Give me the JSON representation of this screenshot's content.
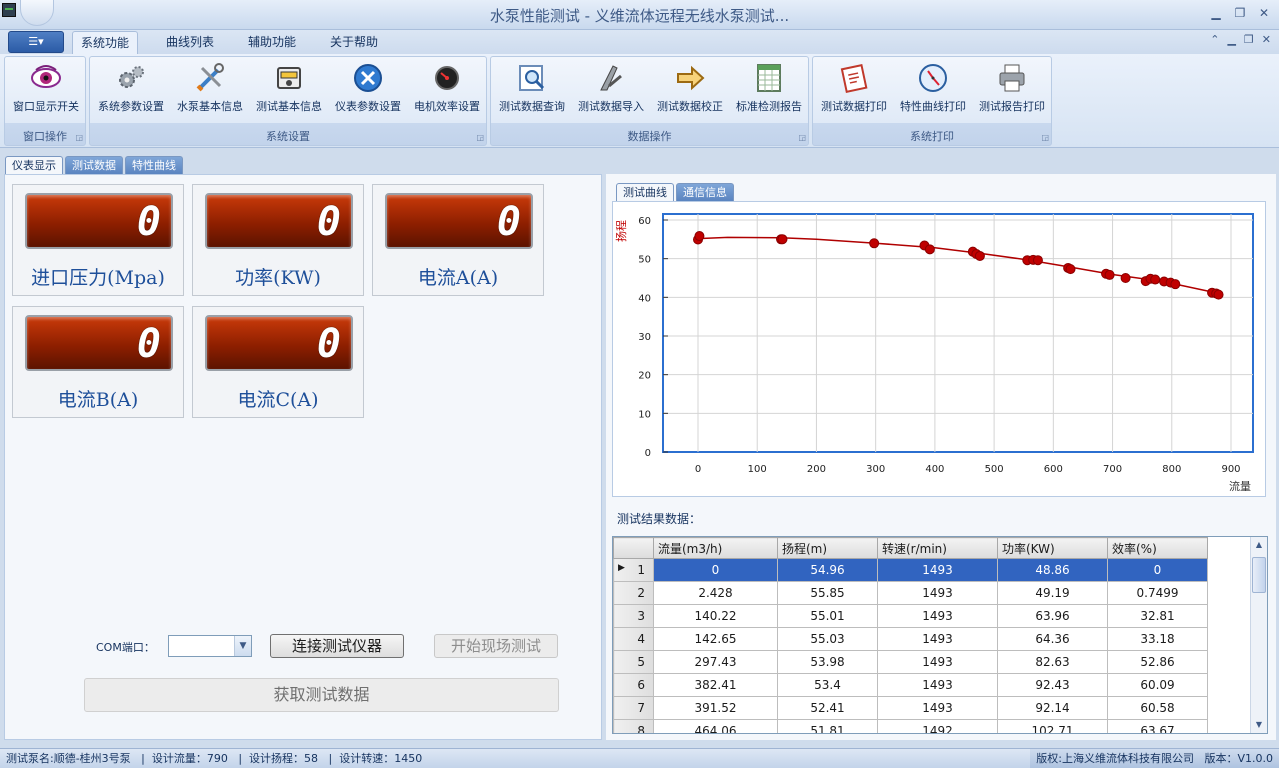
{
  "window": {
    "title": "水泵性能测试 - 义维流体远程无线水泵测试..."
  },
  "ribbon_tabs": [
    "系统功能",
    "曲线列表",
    "辅助功能",
    "关于帮助"
  ],
  "ribbon_groups": {
    "window_ops": {
      "label": "窗口操作",
      "buttons": [
        "窗口显示开关"
      ]
    },
    "system_settings": {
      "label": "系统设置",
      "buttons": [
        "系统参数设置",
        "水泵基本信息",
        "测试基本信息",
        "仪表参数设置",
        "电机效率设置"
      ]
    },
    "data_ops": {
      "label": "数据操作",
      "buttons": [
        "测试数据查询",
        "测试数据导入",
        "测试数据校正",
        "标准检测报告"
      ]
    },
    "system_print": {
      "label": "系统打印",
      "buttons": [
        "测试数据打印",
        "特性曲线打印",
        "测试报告打印"
      ]
    }
  },
  "main_tabs": [
    "仪表显示",
    "测试数据",
    "特性曲线"
  ],
  "meters": [
    {
      "value": "0",
      "label": "进口压力(Mpa)"
    },
    {
      "value": "0",
      "label": "功率(KW)"
    },
    {
      "value": "0",
      "label": "电流A(A)"
    },
    {
      "value": "0",
      "label": "电流B(A)"
    },
    {
      "value": "0",
      "label": "电流C(A)"
    }
  ],
  "controls": {
    "com_label": "COM端口：",
    "com_value": "",
    "connect_button": "连接测试仪器",
    "start_button": "开始现场测试",
    "fetch_button": "获取测试数据"
  },
  "right_tabs": [
    "测试曲线",
    "通信信息"
  ],
  "chart_data": {
    "type": "scatter",
    "ylabel": "扬程",
    "xlabel": "流量",
    "xlim": [
      0,
      900
    ],
    "ylim": [
      0,
      60
    ],
    "xticks": [
      "0",
      "100",
      "200",
      "300",
      "400",
      "500",
      "600",
      "700",
      "800",
      "900"
    ],
    "yticks": [
      "0",
      "10",
      "20",
      "30",
      "40",
      "50",
      "60"
    ],
    "grid": true,
    "series": [
      {
        "color": "#c00000",
        "points": [
          [
            0,
            54.96
          ],
          [
            2.428,
            55.85
          ],
          [
            140.22,
            55.01
          ],
          [
            142.65,
            55.03
          ],
          [
            297.43,
            53.98
          ],
          [
            382.41,
            53.4
          ],
          [
            391.52,
            52.41
          ],
          [
            464.06,
            51.81
          ],
          [
            470,
            51.2
          ],
          [
            476,
            50.7
          ],
          [
            556,
            49.6
          ],
          [
            566,
            49.7
          ],
          [
            574,
            49.6
          ],
          [
            625,
            47.6
          ],
          [
            629,
            47.3
          ],
          [
            689,
            46.1
          ],
          [
            695,
            45.8
          ],
          [
            722,
            45.0
          ],
          [
            756,
            44.2
          ],
          [
            764,
            44.8
          ],
          [
            772,
            44.6
          ],
          [
            787,
            44.1
          ],
          [
            798,
            43.8
          ],
          [
            806,
            43.4
          ],
          [
            868,
            41.2
          ],
          [
            875,
            41.0
          ],
          [
            879,
            40.7
          ]
        ],
        "curve": [
          [
            0,
            55.2
          ],
          [
            50,
            55.5
          ],
          [
            140,
            55.4
          ],
          [
            200,
            55.0
          ],
          [
            300,
            54.0
          ],
          [
            400,
            52.8
          ],
          [
            480,
            51.3
          ],
          [
            560,
            49.6
          ],
          [
            630,
            47.8
          ],
          [
            700,
            45.9
          ],
          [
            760,
            44.6
          ],
          [
            810,
            43.3
          ],
          [
            880,
            41.0
          ]
        ]
      }
    ]
  },
  "results": {
    "title": "测试结果数据：",
    "columns": [
      "流量(m3/h)",
      "扬程(m)",
      "转速(r/min)",
      "功率(KW)",
      "效率(%)"
    ],
    "rows": [
      {
        "n": "1",
        "cells": [
          "0",
          "54.96",
          "1493",
          "48.86",
          "0"
        ]
      },
      {
        "n": "2",
        "cells": [
          "2.428",
          "55.85",
          "1493",
          "49.19",
          "0.7499"
        ]
      },
      {
        "n": "3",
        "cells": [
          "140.22",
          "55.01",
          "1493",
          "63.96",
          "32.81"
        ]
      },
      {
        "n": "4",
        "cells": [
          "142.65",
          "55.03",
          "1493",
          "64.36",
          "33.18"
        ]
      },
      {
        "n": "5",
        "cells": [
          "297.43",
          "53.98",
          "1493",
          "82.63",
          "52.86"
        ]
      },
      {
        "n": "6",
        "cells": [
          "382.41",
          "53.4",
          "1493",
          "92.43",
          "60.09"
        ]
      },
      {
        "n": "7",
        "cells": [
          "391.52",
          "52.41",
          "1493",
          "92.14",
          "60.58"
        ]
      },
      {
        "n": "8",
        "cells": [
          "464.06",
          "51.81",
          "1492",
          "102.71",
          "63.67"
        ]
      }
    ]
  },
  "status": {
    "left": "测试泵名:顺德-桂州3号泵   |  设计流量：790   |  设计扬程：58   |  设计转速：1450",
    "right": "版权:上海义维流体科技有限公司   版本：V1.0.0"
  }
}
